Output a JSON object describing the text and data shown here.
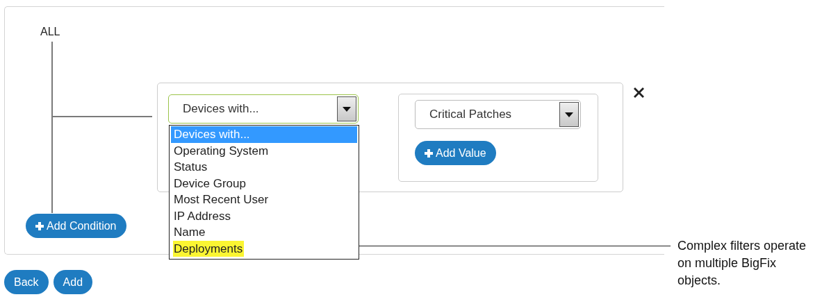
{
  "filter": {
    "root_label": "ALL",
    "conditions": [
      {
        "field_select": {
          "value": "Devices with...",
          "focused": true,
          "open": true,
          "options": [
            {
              "label": "Devices with...",
              "selected": true,
              "highlighted": false
            },
            {
              "label": "Operating System",
              "selected": false,
              "highlighted": false
            },
            {
              "label": "Status",
              "selected": false,
              "highlighted": false
            },
            {
              "label": "Device Group",
              "selected": false,
              "highlighted": false
            },
            {
              "label": "Most Recent User",
              "selected": false,
              "highlighted": false
            },
            {
              "label": "IP Address",
              "selected": false,
              "highlighted": false
            },
            {
              "label": "Name",
              "selected": false,
              "highlighted": false
            },
            {
              "label": "Deployments",
              "selected": false,
              "highlighted": true
            }
          ]
        },
        "value_select": {
          "value": "Critical Patches",
          "focused": false
        },
        "add_value_button": "Add Value"
      }
    ],
    "add_condition_button": "Add Condition"
  },
  "buttons": [
    "Back",
    "Add"
  ],
  "annotation": {
    "text": "Complex filters operate on multiple BigFix objects."
  }
}
